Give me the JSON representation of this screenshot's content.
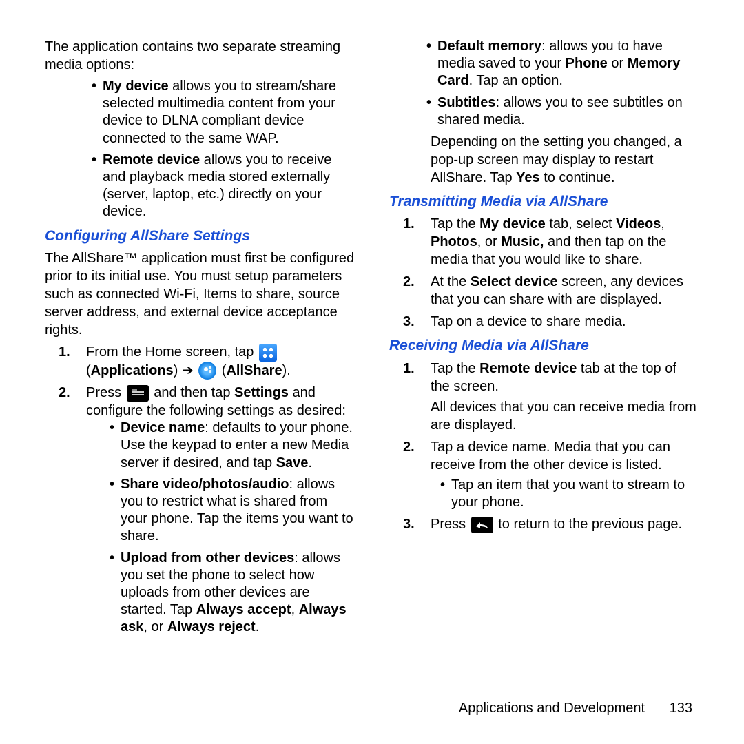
{
  "left": {
    "intro": "The application contains two separate streaming media options:",
    "opts": [
      {
        "b": "My device",
        "t": " allows you to stream/share selected multimedia content from your device to DLNA compliant device connected to the same WAP."
      },
      {
        "b": "Remote device",
        "t": " allows you to receive and playback media stored externally (server, laptop, etc.) directly on your device."
      }
    ],
    "h1": "Configuring AllShare Settings",
    "p1": "The AllShare™ application must first be configured prior to its initial use. You must setup parameters such as connected Wi-Fi, Items to share, source server address, and external device acceptance rights.",
    "s1a": "From the Home screen, tap ",
    "s1b": "(",
    "s1c": "Applications",
    "s1d": ") ➔ ",
    "s1e": " (",
    "s1f": "AllShare",
    "s1g": ").",
    "s2a": "Press ",
    "s2b": " and then tap ",
    "s2c": "Settings",
    "s2d": " and configure the following settings as desired:",
    "cfg": [
      {
        "b": "Device name",
        "t": ": defaults to your phone. Use the keypad to enter a new Media server if desired, and tap ",
        "b2": "Save",
        "t2": "."
      },
      {
        "b": "Share video/photos/audio",
        "t": ": allows you to restrict what is shared from your phone. Tap the items you want to share."
      },
      {
        "b": "Upload from other devices",
        "t": ": allows you set the phone to select how uploads from other devices are started. Tap ",
        "b2": "Always accept",
        "t2": ", ",
        "b3": "Always ask",
        "t3": ", or ",
        "b4": "Always reject",
        "t4": "."
      }
    ]
  },
  "right": {
    "more": [
      {
        "b": "Default memory",
        "t": ": allows you to have media saved to your ",
        "b2": "Phone",
        "t2": " or ",
        "b3": "Memory Card",
        "t3": ". Tap an option."
      },
      {
        "b": "Subtitles",
        "t": ": allows you to see subtitles on shared media."
      }
    ],
    "after": "Depending on the setting you changed, a pop-up screen may display to restart AllShare. Tap ",
    "afterB": "Yes",
    "after2": " to continue.",
    "h2": "Transmitting Media via AllShare",
    "t1a": "Tap the ",
    "t1b": "My device",
    "t1c": " tab, select ",
    "t1d": "Videos",
    "t1e": ", ",
    "t1f": "Photos",
    "t1g": ", or ",
    "t1h": "Music,",
    "t1i": " and then tap on the media that you would like to share.",
    "t2a": "At the ",
    "t2b": "Select device",
    "t2c": " screen, any devices that you can share with are displayed.",
    "t3": "Tap on a device to share media.",
    "h3": "Receiving Media via AllShare",
    "r1a": "Tap the ",
    "r1b": "Remote device",
    "r1c": " tab at the top of the screen.",
    "r1d": "All devices that you can receive media from are displayed.",
    "r2": "Tap a device name. Media that you can receive from the other device is listed.",
    "r2s": "Tap an item that you want to stream to your phone.",
    "r3a": "Press ",
    "r3b": " to return to the previous page."
  },
  "footer": {
    "section": "Applications and Development",
    "page": "133"
  }
}
